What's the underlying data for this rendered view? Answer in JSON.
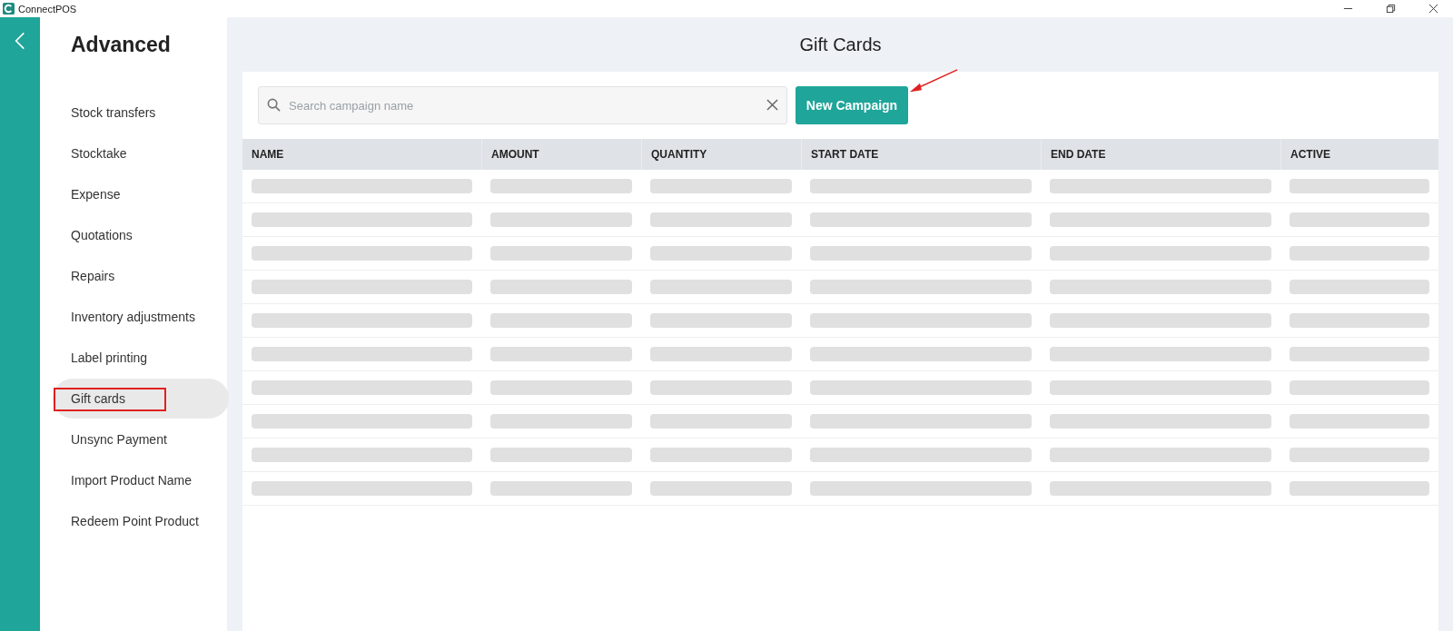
{
  "window": {
    "title": "ConnectPOS"
  },
  "sidebar": {
    "title": "Advanced",
    "items": [
      {
        "label": "Stock transfers",
        "selected": false
      },
      {
        "label": "Stocktake",
        "selected": false
      },
      {
        "label": "Expense",
        "selected": false
      },
      {
        "label": "Quotations",
        "selected": false
      },
      {
        "label": "Repairs",
        "selected": false
      },
      {
        "label": "Inventory adjustments",
        "selected": false
      },
      {
        "label": "Label printing",
        "selected": false
      },
      {
        "label": "Gift cards",
        "selected": true
      },
      {
        "label": "Unsync Payment",
        "selected": false
      },
      {
        "label": "Import Product Name",
        "selected": false
      },
      {
        "label": "Redeem Point Product",
        "selected": false
      }
    ]
  },
  "page": {
    "title": "Gift Cards"
  },
  "search": {
    "placeholder": "Search campaign name"
  },
  "new_button": {
    "label": "New Campaign"
  },
  "table": {
    "columns": [
      "NAME",
      "AMOUNT",
      "QUANTITY",
      "START DATE",
      "END DATE",
      "ACTIVE"
    ],
    "rows": [
      {
        "kind": "loading"
      },
      {
        "kind": "loading"
      },
      {
        "kind": "loading"
      },
      {
        "kind": "loading"
      },
      {
        "kind": "loading"
      },
      {
        "kind": "loading"
      },
      {
        "kind": "loading"
      },
      {
        "kind": "loading"
      },
      {
        "kind": "loading"
      },
      {
        "kind": "loading"
      }
    ]
  }
}
